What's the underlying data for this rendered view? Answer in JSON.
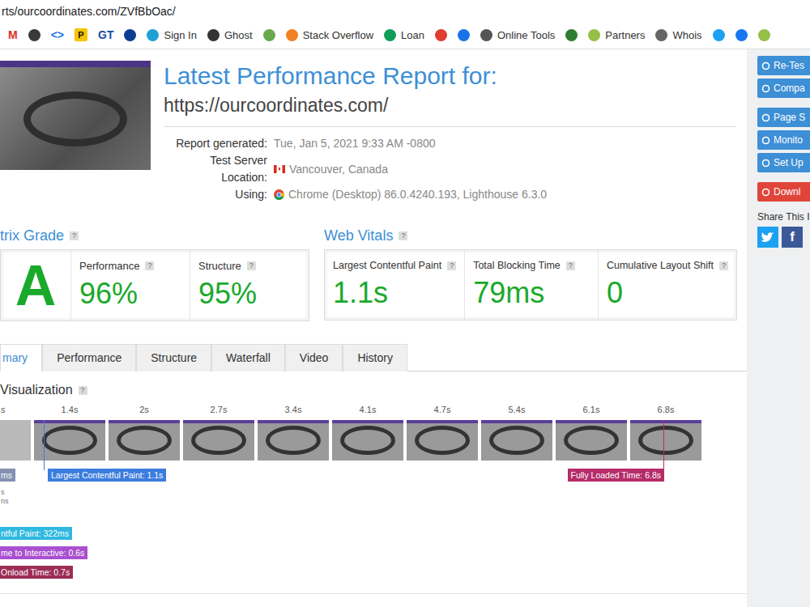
{
  "browser": {
    "url": "rts/ourcoordinates.com/ZVfBbOac/",
    "bookmarks": [
      {
        "kind": "letter",
        "glyph": "M",
        "label": "",
        "color": "#d93025"
      },
      {
        "kind": "dot",
        "glyph": "",
        "label": "",
        "color": "#3a3a3a"
      },
      {
        "kind": "letter",
        "glyph": "<>",
        "label": "",
        "color": "#1a73e8"
      },
      {
        "kind": "badge",
        "glyph": "P",
        "label": "",
        "color": "#f5c400"
      },
      {
        "kind": "letter",
        "glyph": "GT",
        "label": "",
        "color": "#1a4fa0"
      },
      {
        "kind": "dot",
        "glyph": "",
        "label": "",
        "color": "#0b3d91"
      },
      {
        "kind": "dot",
        "glyph": "",
        "label": "Sign In",
        "color": "#1ea0d5"
      },
      {
        "kind": "dot",
        "glyph": "",
        "label": "Ghost",
        "color": "#333333"
      },
      {
        "kind": "dot",
        "glyph": "",
        "label": "",
        "color": "#6aa84f"
      },
      {
        "kind": "dot",
        "glyph": "",
        "label": "Stack Overflow",
        "color": "#f48024"
      },
      {
        "kind": "dot",
        "glyph": "",
        "label": "Loan",
        "color": "#0f9d58"
      },
      {
        "kind": "dot",
        "glyph": "",
        "label": "",
        "color": "#e03c31"
      },
      {
        "kind": "dot",
        "glyph": "",
        "label": "",
        "color": "#1a73e8"
      },
      {
        "kind": "dot",
        "glyph": "",
        "label": "Online Tools",
        "color": "#555555"
      },
      {
        "kind": "dot",
        "glyph": "",
        "label": "",
        "color": "#2e7d32"
      },
      {
        "kind": "dot",
        "glyph": "",
        "label": "Partners",
        "color": "#95bf47"
      },
      {
        "kind": "dot",
        "glyph": "",
        "label": "Whois",
        "color": "#666666"
      },
      {
        "kind": "dot",
        "glyph": "",
        "label": "",
        "color": "#1da1f2"
      },
      {
        "kind": "dot",
        "glyph": "",
        "label": "",
        "color": "#1877f2"
      },
      {
        "kind": "dot",
        "glyph": "",
        "label": "",
        "color": "#95bf47"
      }
    ]
  },
  "help_badge": "?",
  "report": {
    "title": "Latest Performance Report for:",
    "url": "https://ourcoordinates.com/",
    "meta": [
      {
        "kind": "plain",
        "label": "Report generated:",
        "value": "Tue, Jan 5, 2021 9:33 AM -0800"
      },
      {
        "kind": "flag",
        "label": "Test Server Location:",
        "value": "Vancouver, Canada"
      },
      {
        "kind": "browser",
        "label": "Using:",
        "value": "Chrome (Desktop) 86.0.4240.193, Lighthouse 6.3.0"
      }
    ]
  },
  "grade": {
    "title": "trix Grade",
    "letter": "A",
    "metrics": [
      {
        "label": "Performance",
        "value": "96%"
      },
      {
        "label": "Structure",
        "value": "95%"
      }
    ]
  },
  "web_vitals": {
    "title": "Web Vitals",
    "metrics": [
      {
        "label": "Largest Contentful Paint",
        "value": "1.1s"
      },
      {
        "label": "Total Blocking Time",
        "value": "79ms"
      },
      {
        "label": "Cumulative Layout Shift",
        "value": "0"
      }
    ]
  },
  "tabs": [
    {
      "label": "mary",
      "selected": true
    },
    {
      "label": "Performance",
      "selected": false
    },
    {
      "label": "Structure",
      "selected": false
    },
    {
      "label": "Waterfall",
      "selected": false
    },
    {
      "label": "Video",
      "selected": false
    },
    {
      "label": "History",
      "selected": false
    }
  ],
  "visualization": {
    "title": "Visualization",
    "frames": [
      {
        "time": "s",
        "blank": true
      },
      {
        "time": "1.4s",
        "blank": false
      },
      {
        "time": "2s",
        "blank": false
      },
      {
        "time": "2.7s",
        "blank": false
      },
      {
        "time": "3.4s",
        "blank": false
      },
      {
        "time": "4.1s",
        "blank": false
      },
      {
        "time": "4.7s",
        "blank": false
      },
      {
        "time": "5.4s",
        "blank": false
      },
      {
        "time": "6.1s",
        "blank": false
      },
      {
        "time": "6.8s",
        "blank": false
      }
    ],
    "top_markers": [
      {
        "label": "ms",
        "color": "#8391b0"
      },
      {
        "label": "Largest Contentful Paint: 1.1s",
        "color": "#3b7ddd"
      },
      {
        "label": "Fully Loaded Time: 6.8s",
        "color": "#b52c68"
      }
    ],
    "notes": [
      "s",
      "ns"
    ],
    "left_markers": [
      {
        "label": "ntful Paint: 322ms",
        "color": "#2fb8e0"
      },
      {
        "label": "me to Interactive: 0.6s",
        "color": "#a950d0"
      },
      {
        "label": "Onload Time: 0.7s",
        "color": "#9c2d57"
      }
    ]
  },
  "sidebar": {
    "groups": [
      [
        {
          "label": "Re-Tes",
          "color": "#3d8fd6"
        },
        {
          "label": "Compa",
          "color": "#3d8fd6"
        }
      ],
      [
        {
          "label": "Page S",
          "color": "#3d8fd6"
        },
        {
          "label": "Monito",
          "color": "#3d8fd6"
        },
        {
          "label": "Set Up",
          "color": "#3d8fd6"
        }
      ],
      [
        {
          "label": "Downl",
          "color": "#e0453a"
        }
      ]
    ],
    "share_title": "Share This I",
    "share_buttons": [
      {
        "glyph": "",
        "color": "#1da1f2"
      },
      {
        "glyph": "f",
        "color": "#3b5998"
      }
    ]
  }
}
